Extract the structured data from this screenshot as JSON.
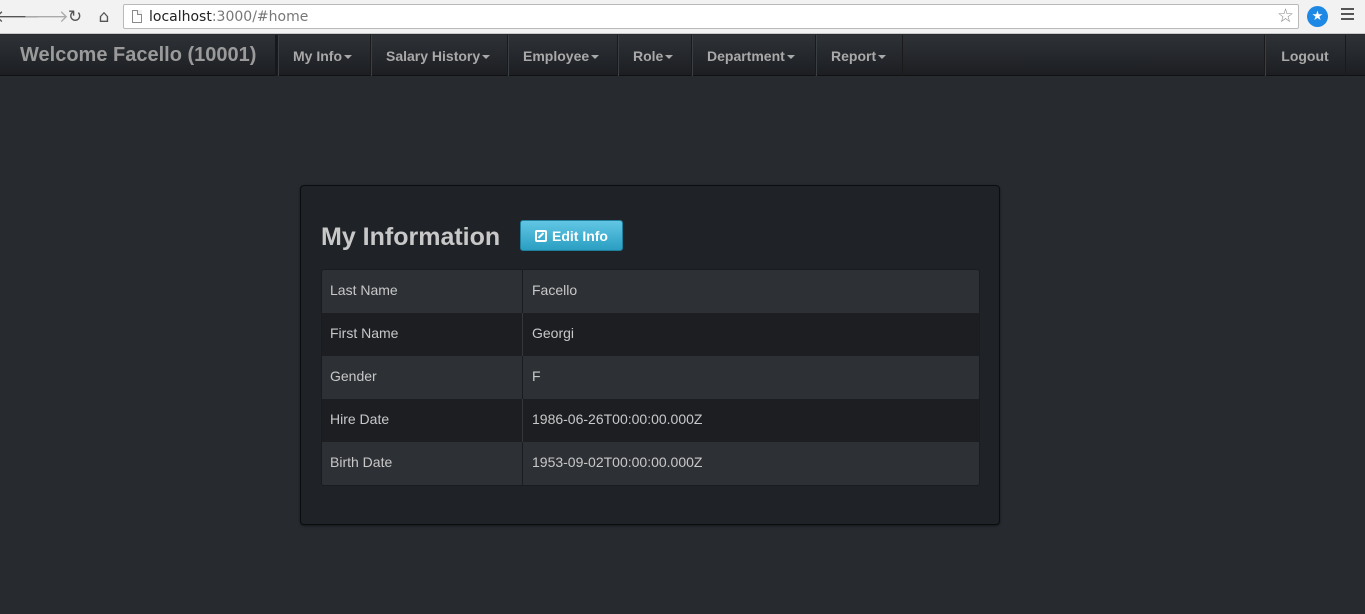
{
  "browser": {
    "url_host": "localhost",
    "url_rest": ":3000/#home",
    "back_glyph": "🡐",
    "forward_glyph": "🡒",
    "reload_glyph": "↻",
    "home_glyph": "⌂",
    "star_glyph": "☆",
    "ext_glyph": "★",
    "icons": [
      "back-arrow-icon",
      "forward-arrow-icon",
      "reload-icon",
      "home-icon",
      "page-icon",
      "bookmark-star-icon",
      "extension-icon",
      "chrome-menu-icon"
    ]
  },
  "navbar": {
    "brand": "Welcome Facello (10001)",
    "items": [
      {
        "label": "My Info"
      },
      {
        "label": "Salary History"
      },
      {
        "label": "Employee"
      },
      {
        "label": "Role"
      },
      {
        "label": "Department"
      },
      {
        "label": "Report"
      }
    ],
    "logout": "Logout"
  },
  "panel": {
    "title": "My Information",
    "edit_button": "Edit Info",
    "rows": [
      {
        "key": "Last Name",
        "value": "Facello"
      },
      {
        "key": "First Name",
        "value": "Georgi"
      },
      {
        "key": "Gender",
        "value": "F"
      },
      {
        "key": "Hire Date",
        "value": "1986-06-26T00:00:00.000Z"
      },
      {
        "key": "Birth Date",
        "value": "1953-09-02T00:00:00.000Z"
      }
    ]
  },
  "colors": {
    "background": "#272b30",
    "navbar": "#1c1e22",
    "accent_button": "#2a9ec2"
  }
}
